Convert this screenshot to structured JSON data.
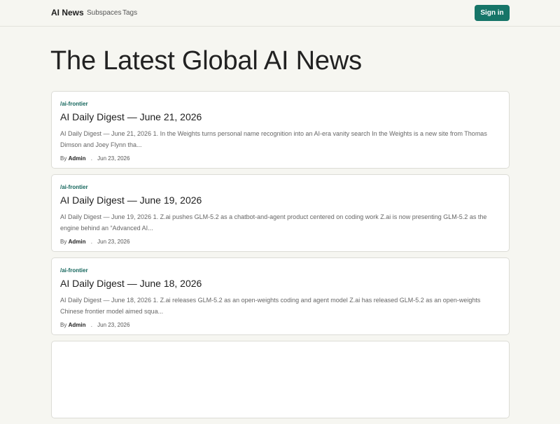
{
  "nav": {
    "brand": "AI News",
    "links": [
      "Subspaces",
      "Tags"
    ],
    "signin_label": "Sign in"
  },
  "page": {
    "title": "The Latest Global AI News"
  },
  "posts": [
    {
      "tag": "/ai-frontier",
      "title": "AI Daily Digest — June 21, 2026",
      "excerpt": "AI Daily Digest — June 21, 2026 1. In the Weights turns personal name recognition into an AI-era vanity search In the Weights is a new site from Thomas Dimson and Joey Flynn tha...",
      "by": "By",
      "author": "Admin",
      "separator": ".",
      "date": "Jun 23, 2026"
    },
    {
      "tag": "/ai-frontier",
      "title": "AI Daily Digest — June 19, 2026",
      "excerpt": "AI Daily Digest — June 19, 2026 1. Z.ai pushes GLM-5.2 as a chatbot-and-agent product centered on coding work Z.ai is now presenting GLM-5.2 as the engine behind an “Advanced AI...",
      "by": "By",
      "author": "Admin",
      "separator": ".",
      "date": "Jun 23, 2026"
    },
    {
      "tag": "/ai-frontier",
      "title": "AI Daily Digest — June 18, 2026",
      "excerpt": "AI Daily Digest — June 18, 2026 1. Z.ai releases GLM-5.2 as an open-weights coding and agent model Z.ai has released GLM-5.2 as an open-weights Chinese frontier model aimed squa...",
      "by": "By",
      "author": "Admin",
      "separator": ".",
      "date": "Jun 23, 2026"
    }
  ],
  "colors": {
    "background": "#f6f6f1",
    "accent": "#167568",
    "tag": "#14665c"
  }
}
